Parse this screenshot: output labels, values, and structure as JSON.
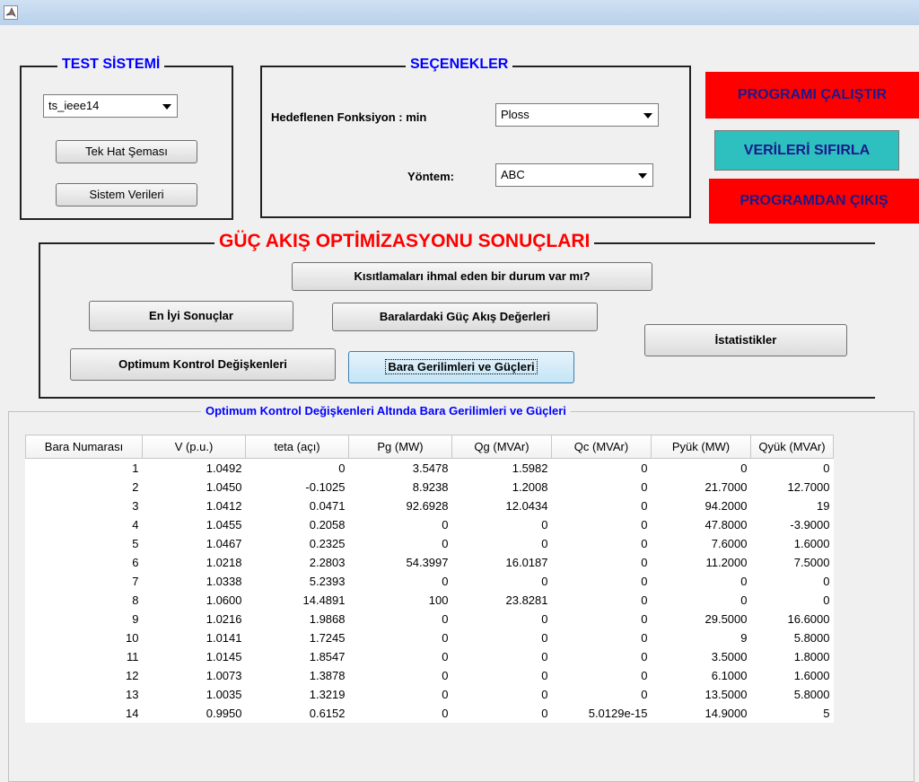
{
  "window": {
    "icon": "matlab-icon"
  },
  "test_system": {
    "title": "TEST SİSTEMİ",
    "select_value": "ts_ieee14",
    "one_line_btn": "Tek Hat Şeması",
    "system_data_btn": "Sistem Verileri"
  },
  "options": {
    "title": "SEÇENEKLER",
    "objective_label": "Hedeflenen Fonksiyon : min",
    "objective_value": "Ploss",
    "method_label": "Yöntem:",
    "method_value": "ABC"
  },
  "actions": {
    "run": "PROGRAMI ÇALIŞTIR",
    "reset": "VERİLERİ SIFIRLA",
    "exit": "PROGRAMDAN ÇIKIŞ",
    "run_color": "#ff0000",
    "reset_color": "#2ebfbf",
    "exit_color": "#ff0000"
  },
  "results": {
    "title": "GÜÇ AKIŞ OPTİMİZASYONU SONUÇLARI",
    "title_color": "#ff0000",
    "constraints_btn": "Kısıtlamaları ihmal eden bir durum var mı?",
    "best_btn": "En İyi Sonuçlar",
    "flow_btn": "Baralardaki Güç Akış Değerleri",
    "stats_btn": "İstatistikler",
    "control_btn": "Optimum Kontrol Değişkenleri",
    "voltage_btn": "Bara Gerilimleri ve Güçleri"
  },
  "table": {
    "title": "Optimum Kontrol Değişkenleri Altında Bara Gerilimleri ve Güçleri",
    "title_color": "#0000ff",
    "headers": [
      "Bara Numarası",
      "V (p.u.)",
      "teta (açı)",
      "Pg (MW)",
      "Qg (MVAr)",
      "Qc (MVAr)",
      "Pyük (MW)",
      "Qyük (MVAr)"
    ],
    "rows": [
      [
        "1",
        "1.0492",
        "0",
        "3.5478",
        "1.5982",
        "0",
        "0",
        "0"
      ],
      [
        "2",
        "1.0450",
        "-0.1025",
        "8.9238",
        "1.2008",
        "0",
        "21.7000",
        "12.7000"
      ],
      [
        "3",
        "1.0412",
        "0.0471",
        "92.6928",
        "12.0434",
        "0",
        "94.2000",
        "19"
      ],
      [
        "4",
        "1.0455",
        "0.2058",
        "0",
        "0",
        "0",
        "47.8000",
        "-3.9000"
      ],
      [
        "5",
        "1.0467",
        "0.2325",
        "0",
        "0",
        "0",
        "7.6000",
        "1.6000"
      ],
      [
        "6",
        "1.0218",
        "2.2803",
        "54.3997",
        "16.0187",
        "0",
        "11.2000",
        "7.5000"
      ],
      [
        "7",
        "1.0338",
        "5.2393",
        "0",
        "0",
        "0",
        "0",
        "0"
      ],
      [
        "8",
        "1.0600",
        "14.4891",
        "100",
        "23.8281",
        "0",
        "0",
        "0"
      ],
      [
        "9",
        "1.0216",
        "1.9868",
        "0",
        "0",
        "0",
        "29.5000",
        "16.6000"
      ],
      [
        "10",
        "1.0141",
        "1.7245",
        "0",
        "0",
        "0",
        "9",
        "5.8000"
      ],
      [
        "11",
        "1.0145",
        "1.8547",
        "0",
        "0",
        "0",
        "3.5000",
        "1.8000"
      ],
      [
        "12",
        "1.0073",
        "1.3878",
        "0",
        "0",
        "0",
        "6.1000",
        "1.6000"
      ],
      [
        "13",
        "1.0035",
        "1.3219",
        "0",
        "0",
        "0",
        "13.5000",
        "5.8000"
      ],
      [
        "14",
        "0.9950",
        "0.6152",
        "0",
        "0",
        "5.0129e-15",
        "14.9000",
        "5"
      ]
    ]
  }
}
